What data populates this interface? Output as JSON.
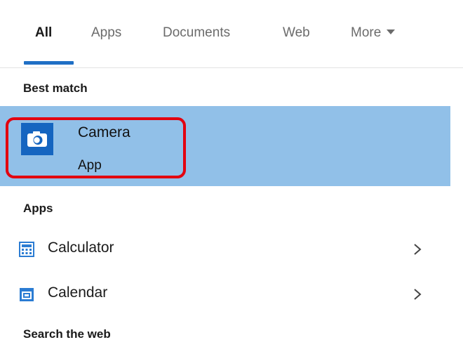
{
  "tabs": {
    "items": [
      {
        "label": "All",
        "active": true
      },
      {
        "label": "Apps",
        "active": false
      },
      {
        "label": "Documents",
        "active": false
      },
      {
        "label": "Web",
        "active": false
      },
      {
        "label": "More",
        "active": false
      }
    ],
    "accent_color": "#1f6fc5"
  },
  "best_match": {
    "header": "Best match",
    "title": "Camera",
    "subtitle": "App",
    "icon": "camera-icon",
    "selected_bg": "#91c0e8",
    "highlight_color": "#e3000f"
  },
  "apps": {
    "header": "Apps",
    "items": [
      {
        "label": "Calculator",
        "icon": "calculator-icon"
      },
      {
        "label": "Calendar",
        "icon": "calendar-icon"
      }
    ]
  },
  "search_web": {
    "header": "Search the web"
  }
}
